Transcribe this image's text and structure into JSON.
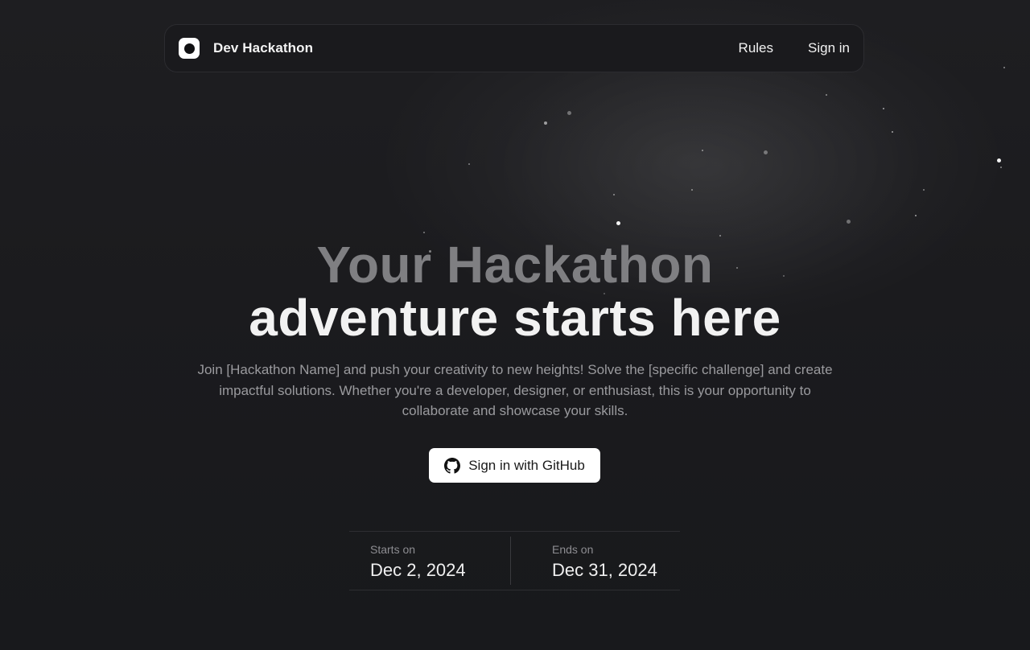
{
  "nav": {
    "brand": "Dev Hackathon",
    "logo_icon": "circle-logo-icon",
    "links": [
      {
        "label": "Rules"
      },
      {
        "label": "Sign in"
      }
    ]
  },
  "hero": {
    "title_line_1": "Your Hackathon",
    "title_line_2": "adventure starts here",
    "description": "Join [Hackathon Name] and push your creativity to new heights! Solve the [specific challenge] and create impactful solutions. Whether you're a developer, designer, or enthusiast, this is your opportunity to collaborate and showcase your skills.",
    "cta_label": "Sign in with GitHub",
    "cta_icon": "github-icon"
  },
  "dates": {
    "start_label": "Starts on",
    "start_value": "Dec 2, 2024",
    "end_label": "Ends on",
    "end_value": "Dec 31, 2024"
  },
  "colors": {
    "background": "#1b1b1e",
    "title_muted": "#7f7f82",
    "title_bright": "#f2f2f2",
    "button_bg": "#ffffff"
  }
}
